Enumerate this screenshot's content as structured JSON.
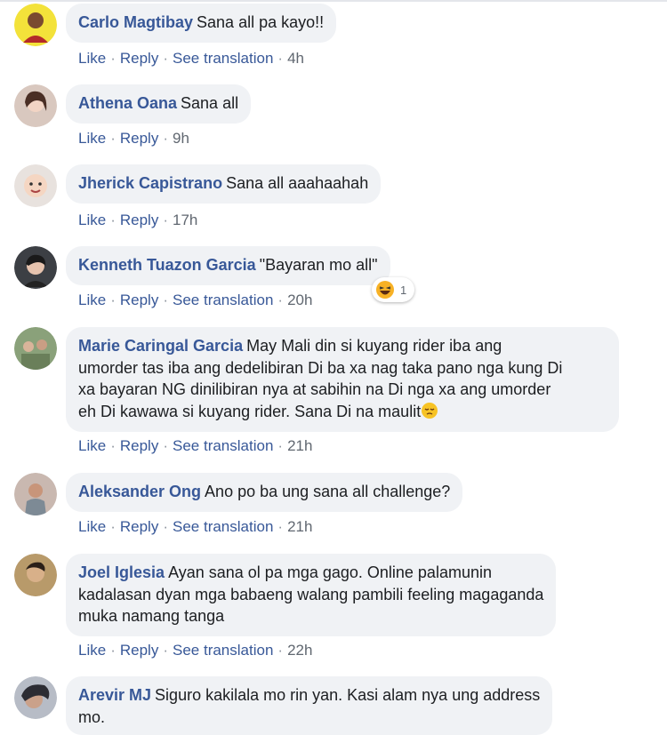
{
  "actions": {
    "like": "Like",
    "reply": "Reply",
    "see_translation": "See translation",
    "sep": "·"
  },
  "comments": [
    {
      "author": "Carlo Magtibay",
      "text": "Sana all pa kayo!!",
      "time": "4h"
    },
    {
      "author": "Athena Oana",
      "text": "Sana all",
      "time": "9h"
    },
    {
      "author": "Jherick Capistrano",
      "text": "Sana all aaahaahah",
      "time": "17h"
    },
    {
      "author": "Kenneth Tuazon Garcia",
      "text": "\"Bayaran mo all\"",
      "time": "20h",
      "reaction_count": "1"
    },
    {
      "author": "Marie Caringal Garcia",
      "text_lines": [
        "May Mali din si kuyang rider iba ang",
        "umorder tas iba ang dedelibiran Di ba xa nag taka pano nga kung Di",
        "xa bayaran NG dinilibiran nya at sabihin na Di nga xa ang umorder",
        "eh Di kawawa si kuyang rider. Sana Di na maulit"
      ],
      "time": "21h"
    },
    {
      "author": "Aleksander Ong",
      "text": "Ano po ba ung sana all challenge?",
      "time": "21h"
    },
    {
      "author": "Joel Iglesia",
      "text_lines": [
        "Ayan sana ol pa mga gago. Online palamunin",
        "kadalasan dyan mga babaeng walang pambili feeling magaganda",
        "muka namang tanga"
      ],
      "time": "22h"
    },
    {
      "author": "Arevir MJ",
      "text_lines": [
        "Siguro kakilala mo rin yan. Kasi alam nya ung address",
        "mo."
      ]
    }
  ]
}
